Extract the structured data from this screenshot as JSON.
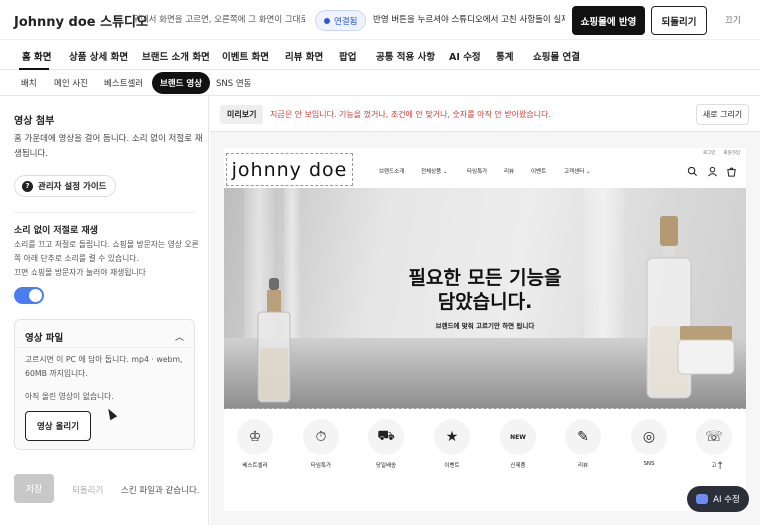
{
  "header": {
    "brand": "Johnny doe 스튜디오",
    "description": "위에서 화면을 고르면, 오른쪽에 그 화면이 그대로 ...",
    "connected_label": "연결됨",
    "message": "반영 버튼을 누르셔야 스튜디오에서 고친 사항들이 실제로 ...",
    "apply_button": "쇼핑몰에 반영",
    "revert_button": "되돌리기",
    "close_label": "끄기"
  },
  "tabs": [
    "홈 화면",
    "상품 상세 화면",
    "브랜드 소개 화면",
    "이벤트 화면",
    "리뷰 화면",
    "팝업",
    "공통 적용 사항",
    "AI 수정",
    "통계",
    "쇼핑몰 연결"
  ],
  "subtabs": [
    "배치",
    "메인 사진",
    "베스트셀러",
    "브랜드 영상",
    "SNS 연동"
  ],
  "left": {
    "video_title": "영상 첨부",
    "video_desc_1": "홈 가운데에 영상을 걸어 둡니다. 소리 없이 저절로 재",
    "video_desc_2": "생됩니다.",
    "guide_button": "관리자 설정 가이드",
    "autoplay_title": "소리 없이 저절로 재생",
    "autoplay_desc_1": "소리를 끄고 저절로 돌립니다. 쇼핑몰 방문자는 영상 오른",
    "autoplay_desc_2": "쪽 아래 단추로 소리를 켤 수 있습니다.",
    "autoplay_desc_3": "끄면 쇼핑몰 방문자가 눌러야 재생됩니다",
    "autoplay_on": true,
    "file_title": "영상 파일",
    "file_desc_1": "고르시면 이 PC 에 담아 둡니다. mp4 · webm,",
    "file_desc_2": "60MB 까지입니다.",
    "file_empty": "아직 올린 영상이 없습니다.",
    "upload_button": "영상 올리기",
    "save_button": "저장",
    "revert_link": "되돌리기",
    "skin_status": "스킨 파일과 같습니다."
  },
  "preview": {
    "chip": "미리보기",
    "message": "지금은 안 보입니다. 기능을 껐거나, 조건에 안 맞거나, 숫자를 아직 안 받아왔습니다.",
    "redraw_button": "새로 그리기"
  },
  "site": {
    "logo": "johnny  doe",
    "toplinks": [
      "로그인",
      "회원가입"
    ],
    "nav": [
      "브랜드소개",
      "전체상품 ⌄",
      "타임특가",
      "리뷰",
      "이벤트",
      "고객센터 ⌄"
    ],
    "hero_title_1": "필요한 모든 기능을",
    "hero_title_2": "담았습니다.",
    "hero_sub": "브랜드에 맞춰 고르기만 하면 됩니다",
    "icons": [
      {
        "label": "베스트셀러",
        "icon": "medal-icon",
        "glyph": "♔"
      },
      {
        "label": "타임특가",
        "icon": "timer-bag-icon",
        "glyph": "⏱"
      },
      {
        "label": "당일배송",
        "icon": "truck-icon",
        "glyph": "⛟"
      },
      {
        "label": "이벤트",
        "icon": "calendar-star-icon",
        "glyph": "★"
      },
      {
        "label": "신제품",
        "icon": "new-badge-icon",
        "glyph": "NEW"
      },
      {
        "label": "리뷰",
        "icon": "pen-icon",
        "glyph": "✎"
      },
      {
        "label": "SNS",
        "icon": "instagram-icon",
        "glyph": "◎"
      },
      {
        "label": "고",
        "icon": "headset-icon",
        "glyph": "☏"
      }
    ]
  },
  "ai_button": "AI 수정",
  "colors": {
    "accent": "#4c7df0",
    "warning_text": "#d23b3b",
    "dark": "#111111"
  }
}
